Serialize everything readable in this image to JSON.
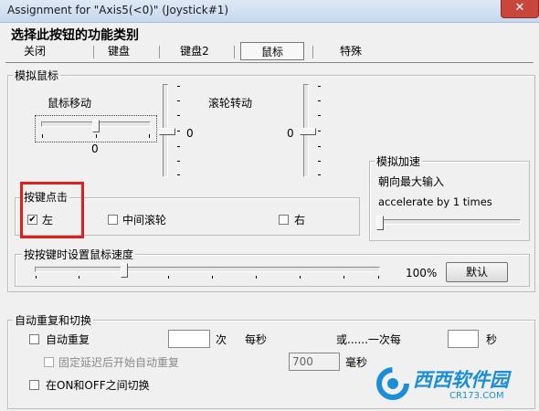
{
  "window": {
    "title": "Assignment for \"Axis5(<0)\" (Joystick#1)",
    "close_glyph": "✕"
  },
  "header": {
    "section_title": "选择此按钮的功能类别"
  },
  "tabs": [
    {
      "label": "关闭"
    },
    {
      "label": "键盘"
    },
    {
      "label": "键盘2"
    },
    {
      "label": "鼠标",
      "active": true
    },
    {
      "label": "特殊"
    }
  ],
  "mouse_emulation": {
    "group_label": "模拟鼠标",
    "mouse_move": {
      "label": "鼠标移动",
      "value": "0"
    },
    "vertical_slider_value": "0",
    "wheel": {
      "label": "滚轮转动",
      "value": "0"
    }
  },
  "acceleration": {
    "group_label": "模拟加速",
    "line1": "朝向最大输入",
    "line2": "accelerate by 1 times"
  },
  "button_click": {
    "group_label": "按键点击",
    "left": {
      "label": "左",
      "checked": true
    },
    "middle": {
      "label": "中间滚轮",
      "checked": false
    },
    "right": {
      "label": "右",
      "checked": false
    }
  },
  "speed": {
    "group_label": "按按键时设置鼠标速度",
    "percent": "100%",
    "default_button": "默认"
  },
  "auto_repeat": {
    "group_label": "自动重复和切换",
    "auto_repeat_label": "自动重复",
    "times_value": "",
    "times_unit": "次",
    "per_second": "每秒",
    "or_once_every": "或......一次每",
    "seconds_value": "",
    "seconds_unit": "秒",
    "fixed_delay_label": "固定延迟后开始自动重复",
    "delay_value": "700",
    "ms_unit": "毫秒",
    "toggle_label": "在ON和OFF之间切换"
  },
  "watermark": {
    "brand": "西西软件园",
    "url": "CR173.COM"
  },
  "colors": {
    "highlight": "#e0201a",
    "titlebar": "#c7d8ee",
    "close": "#c9463d"
  }
}
